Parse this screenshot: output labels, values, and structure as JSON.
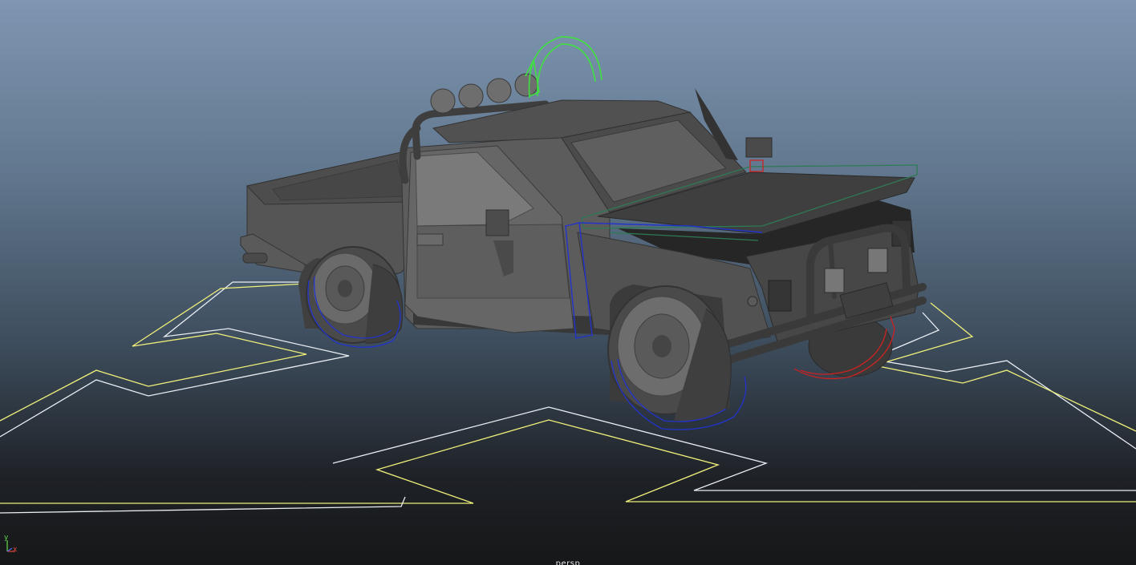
{
  "viewport": {
    "camera_name": "persp",
    "background_top": "#7f96b2",
    "background_bottom": "#161718"
  },
  "axis_gizmo": {
    "y_label": "y",
    "x_label": "x",
    "y_color": "#63d94b",
    "x_color": "#e0473d",
    "z_color": "#4a6cf0"
  },
  "colors": {
    "control_outline_white": "#e9eef4",
    "control_outline_yellow": "#f0f07a",
    "wheel_control_blue": "#2233cc",
    "wheel_control_red": "#cc2222",
    "steering_control_green": "#40e040",
    "hood_control_green": "#2e7a55",
    "truck_body": "#555555"
  },
  "scene": {
    "model": "pickup-truck",
    "controls": [
      "root-control",
      "front-left-wheel-control",
      "rear-left-wheel-control",
      "front-right-wheel-control",
      "door-control",
      "hood-control",
      "steering-arc-control"
    ]
  }
}
